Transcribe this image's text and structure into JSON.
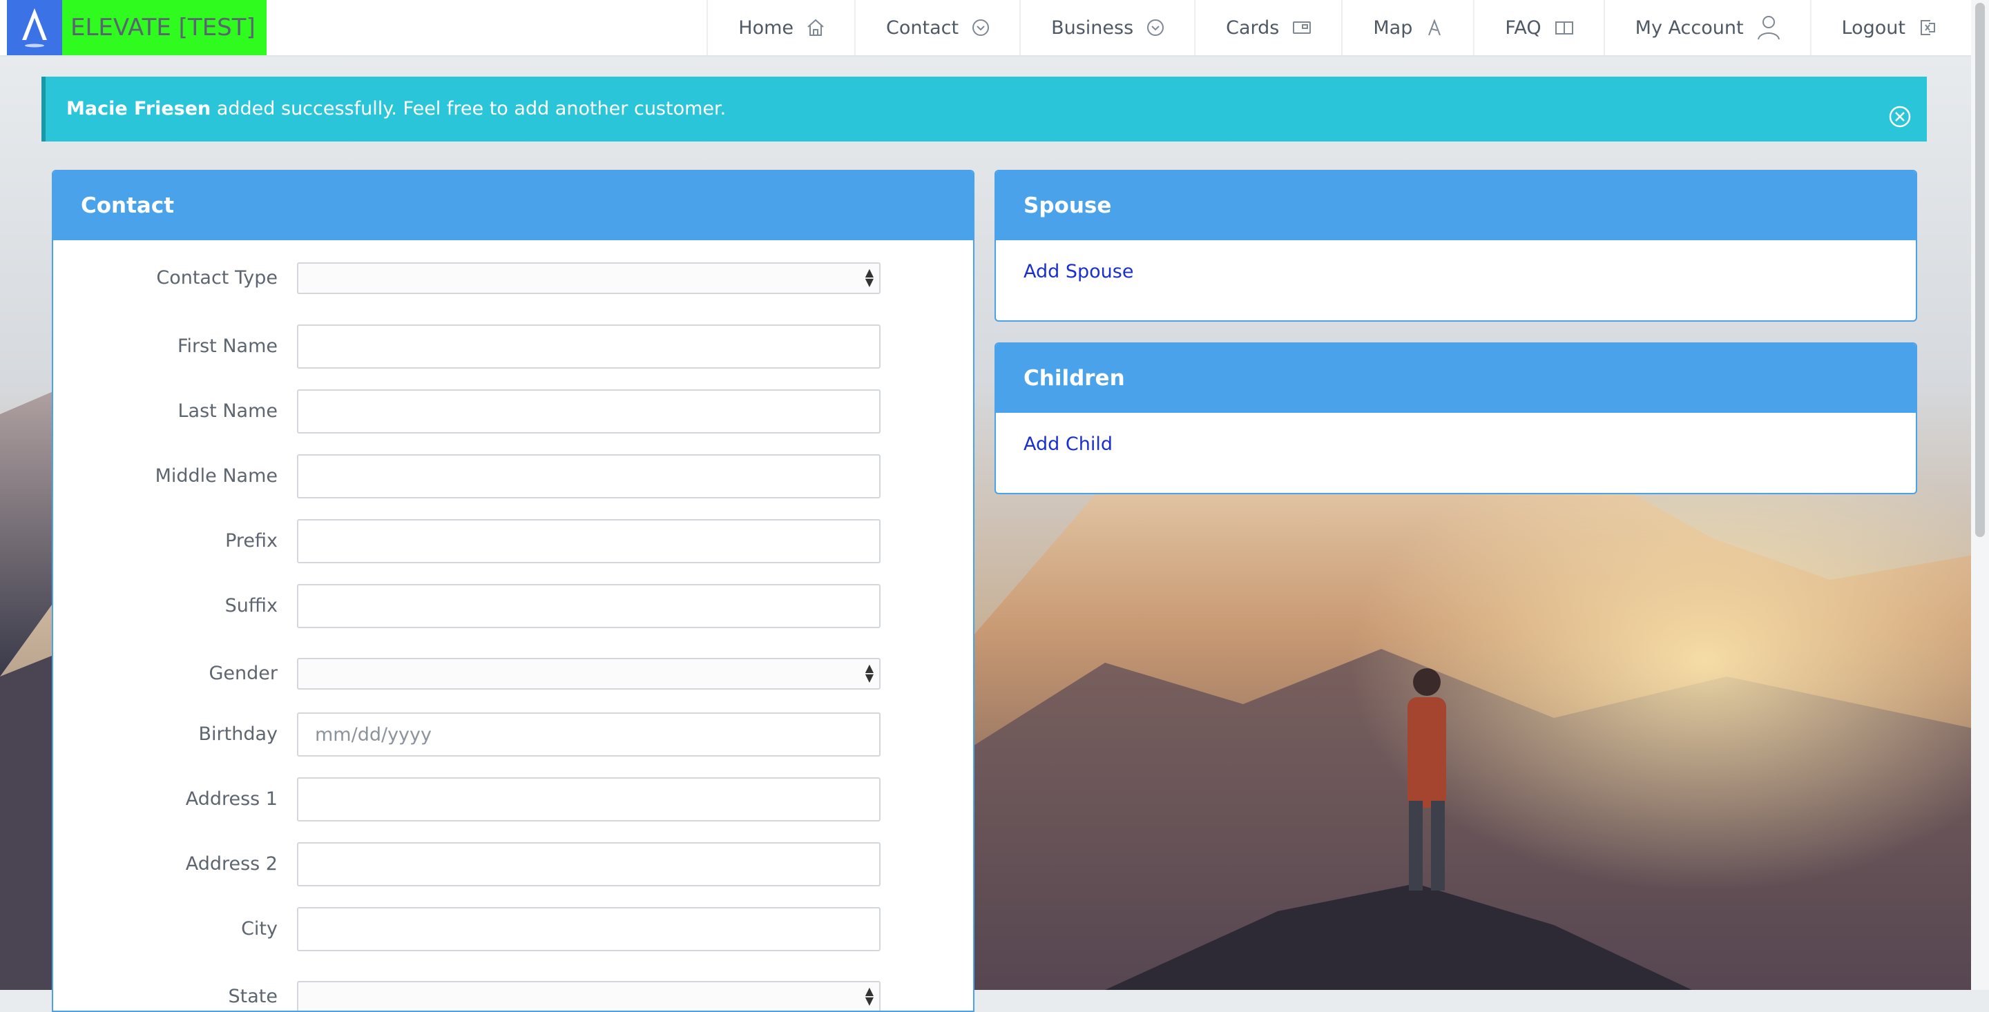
{
  "brand": {
    "name": "ELEVATE [TEST]",
    "logo_bg": "#3b73e6",
    "name_bg": "#2ffb1e"
  },
  "nav": {
    "items": [
      {
        "label": "Home",
        "icon": "home-icon"
      },
      {
        "label": "Contact",
        "icon": "chevron-circle-icon"
      },
      {
        "label": "Business",
        "icon": "chevron-circle-icon"
      },
      {
        "label": "Cards",
        "icon": "card-icon"
      },
      {
        "label": "Map",
        "icon": "map-pen-icon"
      },
      {
        "label": "FAQ",
        "icon": "book-icon"
      },
      {
        "label": "My Account",
        "icon": "user-icon"
      },
      {
        "label": "Logout",
        "icon": "logout-icon"
      }
    ]
  },
  "alert": {
    "name": "Macie Friesen",
    "message": " added successfully. Feel free to add another customer.",
    "color": "#2bc5d9"
  },
  "contact_panel": {
    "title": "Contact",
    "fields": [
      {
        "label": "Contact Type",
        "type": "select",
        "value": ""
      },
      {
        "label": "First Name",
        "type": "text",
        "value": ""
      },
      {
        "label": "Last Name",
        "type": "text",
        "value": ""
      },
      {
        "label": "Middle Name",
        "type": "text",
        "value": ""
      },
      {
        "label": "Prefix",
        "type": "text",
        "value": ""
      },
      {
        "label": "Suffix",
        "type": "text",
        "value": ""
      },
      {
        "label": "Gender",
        "type": "select",
        "value": ""
      },
      {
        "label": "Birthday",
        "type": "text",
        "placeholder": "mm/dd/yyyy",
        "value": ""
      },
      {
        "label": "Address 1",
        "type": "text",
        "value": ""
      },
      {
        "label": "Address 2",
        "type": "text",
        "value": ""
      },
      {
        "label": "City",
        "type": "text",
        "value": ""
      },
      {
        "label": "State",
        "type": "select",
        "value": ""
      }
    ]
  },
  "spouse_panel": {
    "title": "Spouse",
    "link": "Add Spouse"
  },
  "children_panel": {
    "title": "Children",
    "link": "Add Child"
  },
  "colors": {
    "panel_header": "#4aa3ea",
    "link": "#1a2fd0"
  }
}
